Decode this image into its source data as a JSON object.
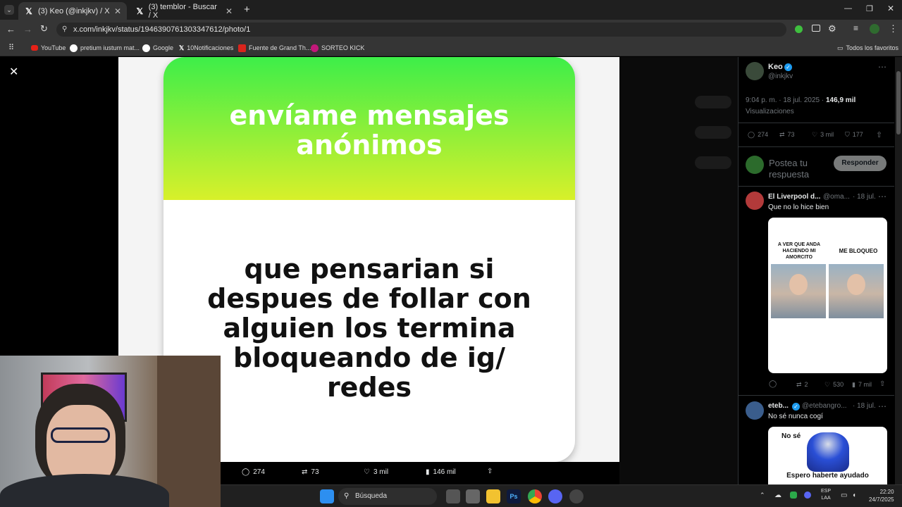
{
  "tabs": [
    {
      "label": "(3) Keo (@inkjkv) / X",
      "active": true
    },
    {
      "label": "(3) temblor - Buscar / X",
      "active": false
    }
  ],
  "url": "x.com/inkjkv/status/1946390761303347612/photo/1",
  "bookmarks": [
    "YouTube",
    "pretium iustum mat...",
    "Google",
    "10Notificaciones",
    "Fuente de Grand Th...",
    "SORTEO KICK"
  ],
  "bookmarks_all": "Todos los favoritos",
  "card": {
    "title": "envíame mensajes anónimos",
    "question": "que pensarian si despues de follar con alguien los termina bloqueando de ig/ redes"
  },
  "photo_actions": {
    "replies": "274",
    "reposts": "73",
    "likes": "3 mil",
    "views": "146 mil"
  },
  "post": {
    "author": "Keo",
    "handle": "@inkjkv",
    "timestamp": "9:04 p. m. · 18 jul. 2025 ·",
    "views_count": "146,9 mil",
    "views_label": "Visualizaciones",
    "replies": "274",
    "reposts": "73",
    "likes": "3 mil",
    "bookmarks": "177"
  },
  "reply_box": {
    "placeholder": "Postea tu respuesta",
    "button": "Responder"
  },
  "replies": [
    {
      "name": "El Liverpool d...",
      "handle": "@oma...",
      "date": "· 18 jul.",
      "text": "Que no lo hice bien",
      "meme_left": "A VER QUE ANDA HACIENDO MI AMORCITO",
      "meme_right": "ME BLOQUEO",
      "reposts": "2",
      "likes": "530",
      "views": "7 mil"
    },
    {
      "name": "eteb...",
      "handle": "@etebangro...",
      "date": "· 18 jul.",
      "text": "No sé nunca cogí",
      "meme_top": "No sé",
      "meme_bottom": "Espero haberte ayudado"
    }
  ],
  "taskbar": {
    "search": "Búsqueda",
    "lang1": "ESP",
    "lang2": "LAA",
    "time": "22:20",
    "date": "24/7/2025"
  },
  "colors": {
    "verified": "#1d9bf0",
    "accent_green": "#3dee49"
  }
}
